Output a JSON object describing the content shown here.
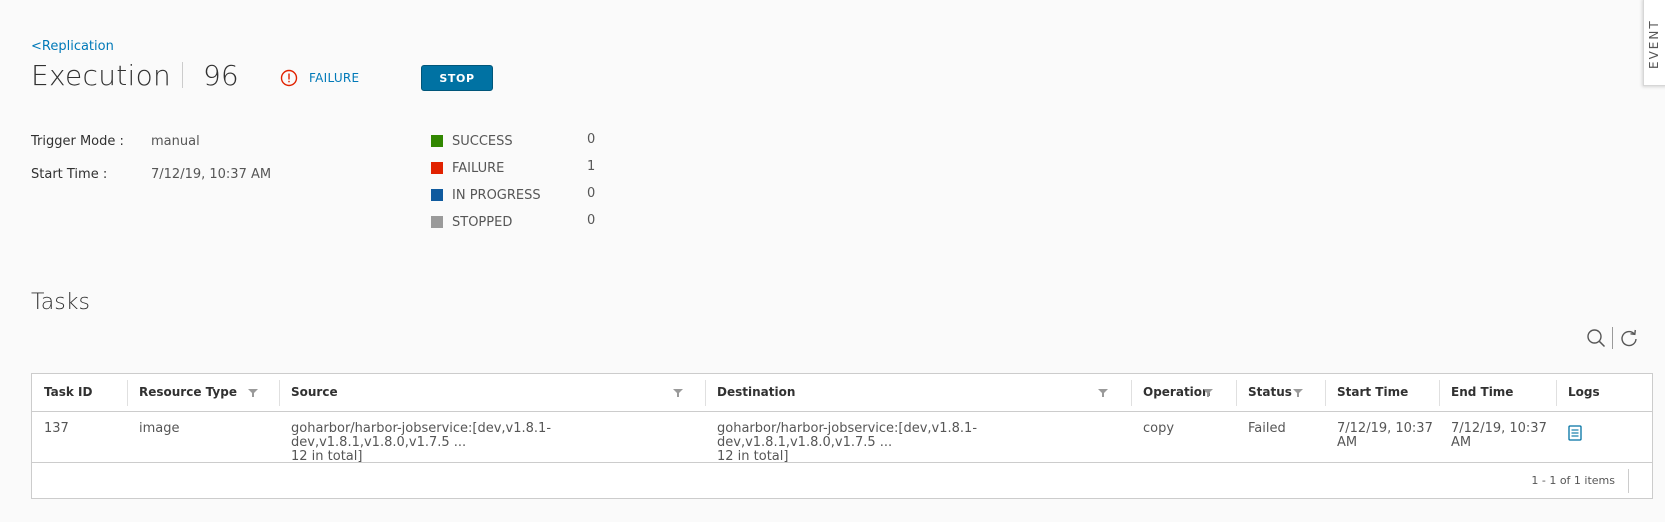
{
  "breadcrumb": {
    "label": "<Replication"
  },
  "header": {
    "title": "Execution",
    "execution_id": "96",
    "status_text": "FAILURE",
    "status_icon": "error-circle-icon",
    "stop_label": "STOP"
  },
  "side_tab": {
    "label": "EVENT"
  },
  "info": {
    "trigger_mode_label": "Trigger Mode :",
    "trigger_mode_value": "manual",
    "start_time_label": "Start Time :",
    "start_time_value": "7/12/19, 10:37 AM"
  },
  "summary": [
    {
      "label": "SUCCESS",
      "count": "0",
      "color": "#318700"
    },
    {
      "label": "FAILURE",
      "count": "1",
      "color": "#e12200"
    },
    {
      "label": "IN PROGRESS",
      "count": "0",
      "color": "#0f5a9e"
    },
    {
      "label": "STOPPED",
      "count": "0",
      "color": "#9a9a9a"
    }
  ],
  "tasks": {
    "title": "Tasks",
    "toolbar": {
      "search_icon": "search-icon",
      "refresh_icon": "refresh-icon"
    },
    "columns": [
      "Task ID",
      "Resource Type",
      "Source",
      "Destination",
      "Operation",
      "Status",
      "Start Time",
      "End Time",
      "Logs"
    ],
    "rows": [
      {
        "task_id": "137",
        "resource_type": "image",
        "source_line1": "goharbor/harbor-jobservice:[dev,v1.8.1-dev,v1.8.1,v1.8.0,v1.7.5 ...",
        "source_line2": "12 in total]",
        "destination_line1": "goharbor/harbor-jobservice:[dev,v1.8.1-dev,v1.8.1,v1.8.0,v1.7.5 ...",
        "destination_line2": "12 in total]",
        "operation": "copy",
        "status": "Failed",
        "start_time_line1": "7/12/19, 10:37",
        "start_time_line2": "AM",
        "end_time_line1": "7/12/19, 10:37",
        "end_time_line2": "AM",
        "logs_icon": "log-document-icon"
      }
    ],
    "footer": "1 - 1 of 1 items"
  },
  "colors": {
    "accent": "#0072a3",
    "link": "#0079b8",
    "error": "#e12200"
  }
}
